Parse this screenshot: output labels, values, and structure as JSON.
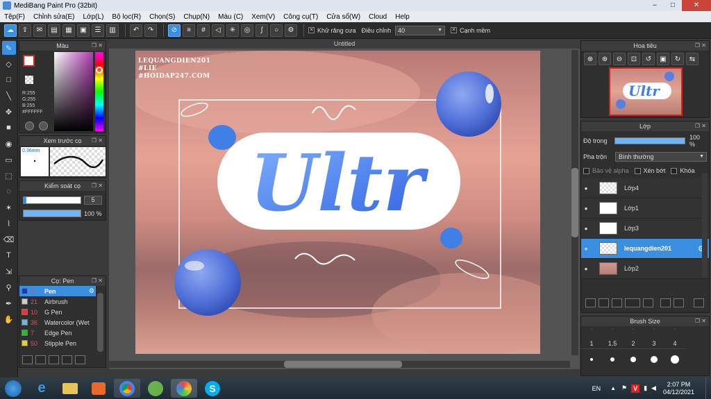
{
  "window": {
    "title": "MediBang Paint Pro (32bit)",
    "min": "–",
    "max": "□",
    "close": "✕"
  },
  "menu": [
    "Tệp(F)",
    "Chỉnh sửa(E)",
    "Lớp(L)",
    "Bộ lọc(R)",
    "Chọn(S)",
    "Chụp(N)",
    "Màu (C)",
    "Xem(V)",
    "Công cụ(T)",
    "Cửa sổ(W)",
    "Cloud",
    "Help"
  ],
  "toolbar": {
    "antialias_label": "Khử răng cưa",
    "adjust_label": "Điều chỉnh",
    "adjust_value": "40",
    "sharp_label": "Cạnh mềm"
  },
  "color_panel": {
    "title": "Màu",
    "r": "R:255",
    "g": "G:255",
    "b": "B:255",
    "hex": "#FFFFFF"
  },
  "brush_preview": {
    "title": "Xem trước cọ",
    "size": "0.36mm"
  },
  "brush_control": {
    "title": "Kiểm soát cọ",
    "size": "5",
    "opacity": "100 %",
    "opacity_fraction": 1.0
  },
  "brush_list": {
    "title": "Cọ: Pen",
    "items": [
      {
        "num": "5",
        "name": "Pen",
        "color": "#1c3ea8"
      },
      {
        "num": "21",
        "name": "Airbrush",
        "color": "#cccccc"
      },
      {
        "num": "10",
        "name": "G Pen",
        "color": "#e03a3a"
      },
      {
        "num": "36",
        "name": "Watercolor (Wet",
        "color": "#6ab7e8"
      },
      {
        "num": "7",
        "name": "Edge Pen",
        "color": "#36b336"
      },
      {
        "num": "50",
        "name": "Stipple Pen",
        "color": "#e8d22a"
      }
    ]
  },
  "document": {
    "tab_title": "Untitled"
  },
  "artwork": {
    "watermark": [
      "LEQUANGDIEN201",
      "#LIE",
      "#HOIDAP247.COM"
    ],
    "letters": "Ultr"
  },
  "navigator": {
    "title": "Hoa tiêu"
  },
  "layers": {
    "title": "Lớp",
    "opacity_label": "Độ trong",
    "opacity_value": "100 %",
    "blend_label": "Pha trộn",
    "blend_value": "Bình thường",
    "protect_alpha": "Bảo vệ alpha",
    "clip": "Xén bớt",
    "lock": "Khóa",
    "items": [
      {
        "name": "Lớp4",
        "selected": false
      },
      {
        "name": "Lớp1",
        "selected": false
      },
      {
        "name": "Lớp3",
        "selected": false
      },
      {
        "name": "lequangdien201",
        "selected": true
      },
      {
        "name": "Lớp2",
        "selected": false
      }
    ]
  },
  "brush_size": {
    "title": "Brush Size",
    "labels": [
      "1",
      "1.5",
      "2",
      "3",
      "4"
    ]
  },
  "taskbar": {
    "lang": "EN",
    "time": "2:07 PM",
    "date": "04/12/2021"
  },
  "colors": {
    "accent": "#3b8fe0",
    "letters": "#3f7fe6",
    "bubble": "#5b7fe0"
  }
}
